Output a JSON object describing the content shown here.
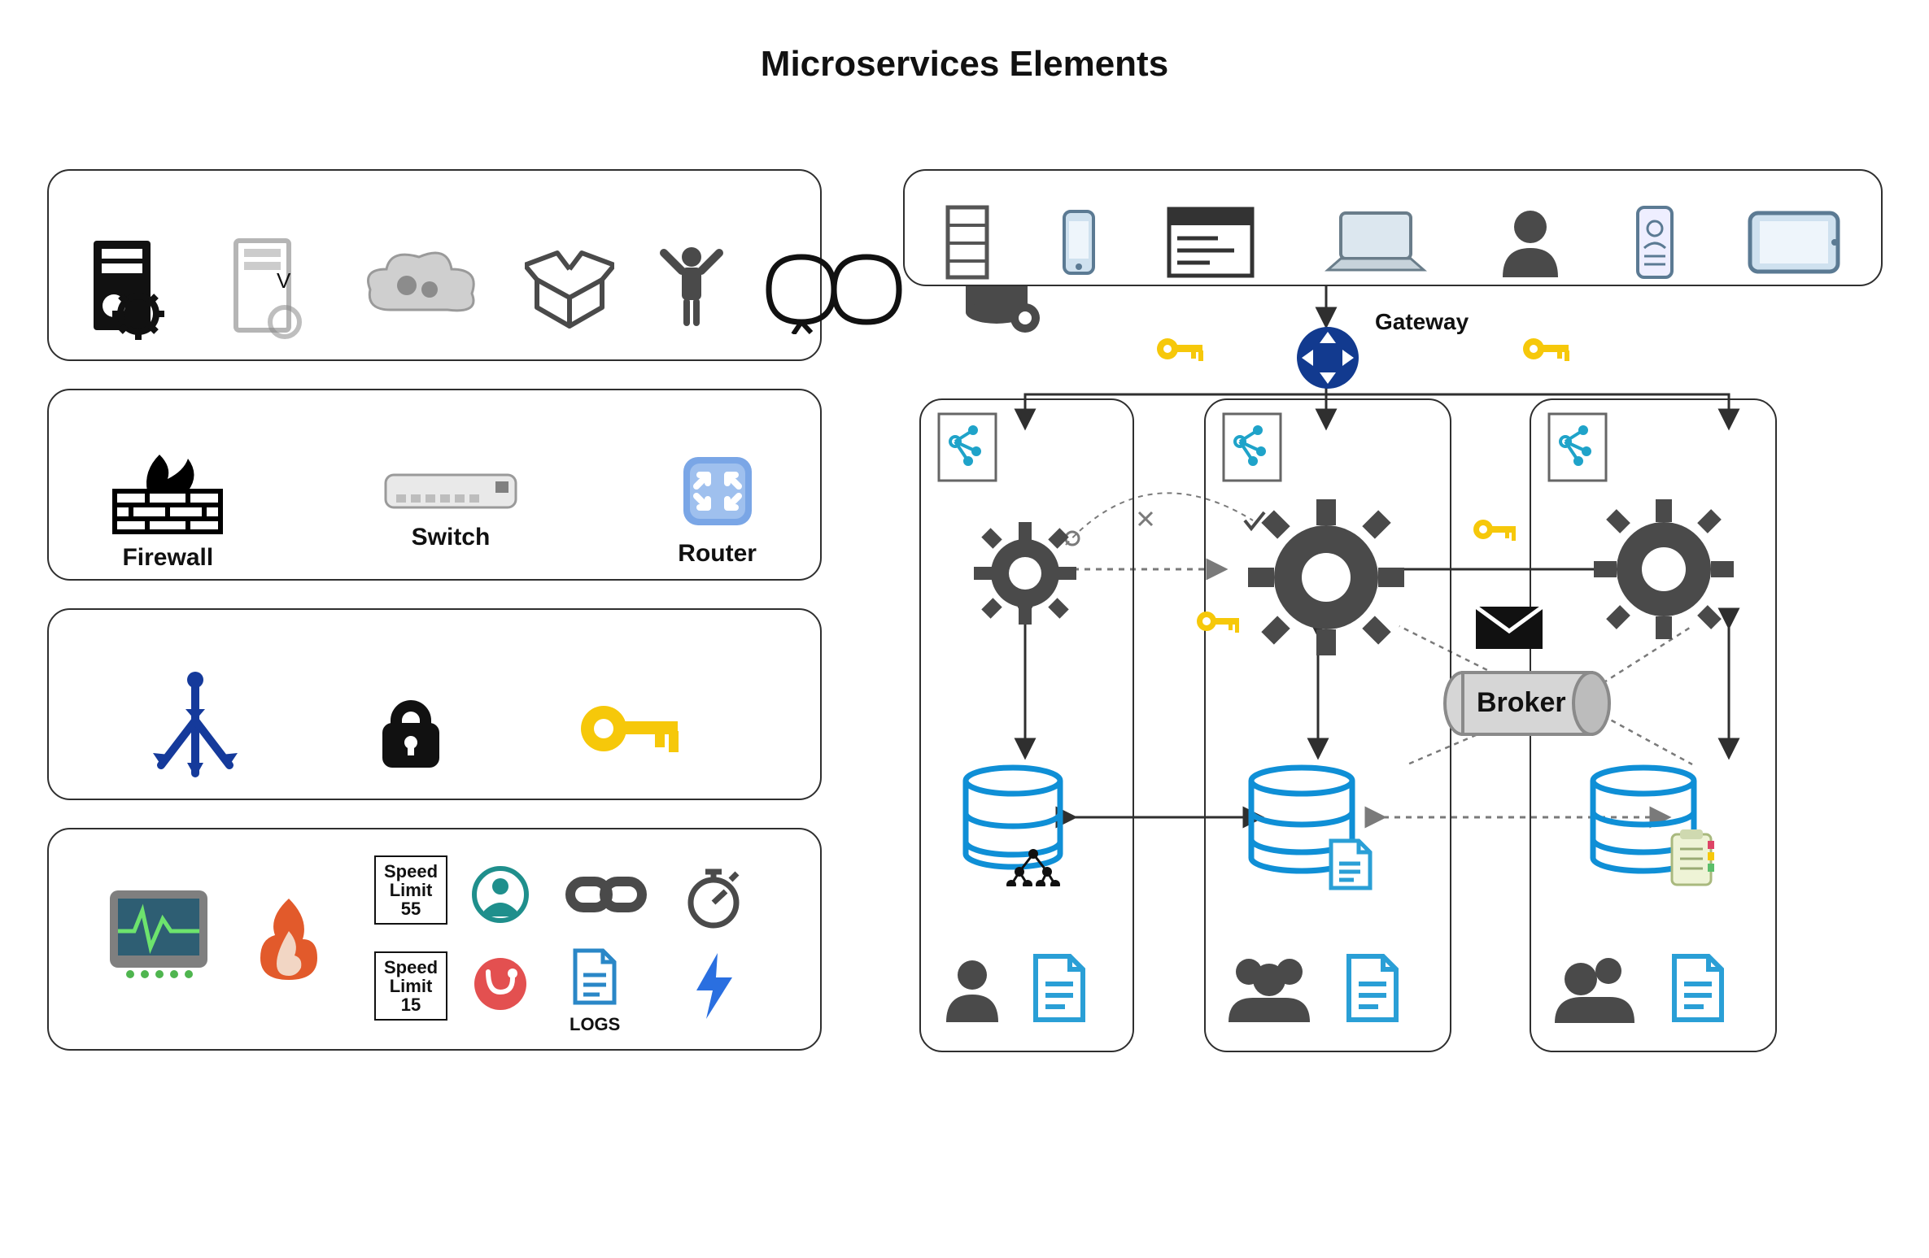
{
  "title": "Microservices Elements",
  "network": {
    "firewall": "Firewall",
    "switch": "Switch",
    "router": "Router"
  },
  "speed": {
    "top": "Speed\nLimit\n55",
    "bottom": "Speed\nLimit\n15"
  },
  "logs": "LOGS",
  "gateway": "Gateway",
  "broker": "Broker",
  "colors": {
    "accentBlue": "#153a9b",
    "keyYellow": "#f6c80a",
    "flameOrange": "#e25a2b",
    "dbBlue": "#0f8fd6",
    "iconGray": "#4a4a4a",
    "lightBlue": "#6fa4d6"
  }
}
